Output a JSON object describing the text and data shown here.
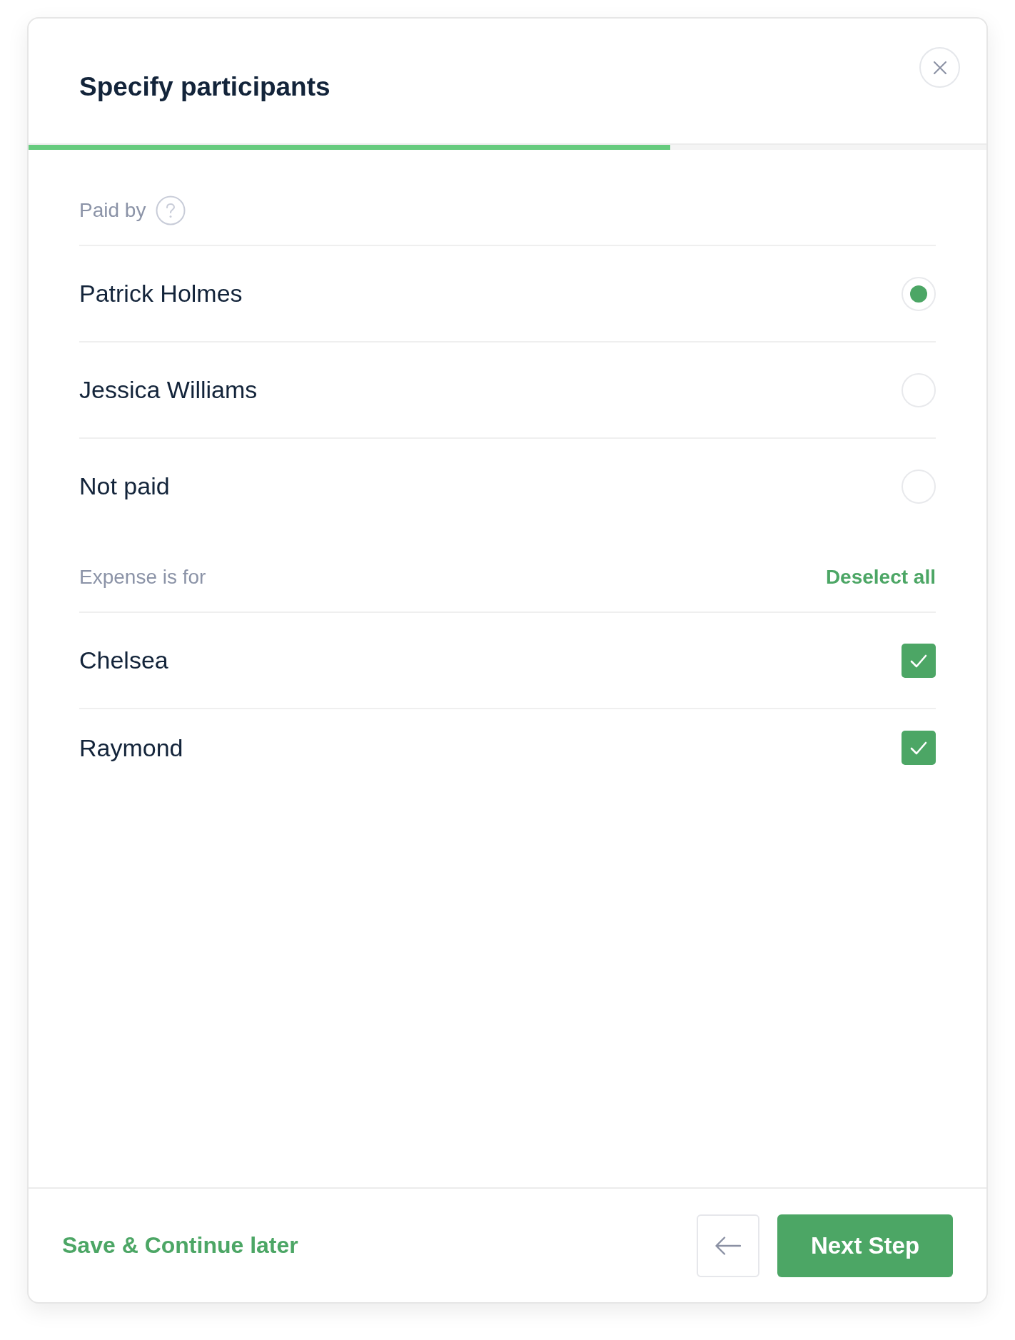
{
  "dialog": {
    "title": "Specify participants"
  },
  "progress": {
    "level": 0.67
  },
  "paid_by": {
    "label": "Paid by",
    "options": [
      {
        "name": "Patrick Holmes",
        "selected": true
      },
      {
        "name": "Jessica Williams",
        "selected": false
      },
      {
        "name": "Not paid",
        "selected": false
      }
    ]
  },
  "expense_for": {
    "label": "Expense is for",
    "action": "Deselect all",
    "participants": [
      {
        "name": "Chelsea",
        "checked": true
      },
      {
        "name": "Raymond",
        "checked": true
      }
    ]
  },
  "footer": {
    "save_link": "Save & Continue later",
    "next_button": "Next Step"
  }
}
